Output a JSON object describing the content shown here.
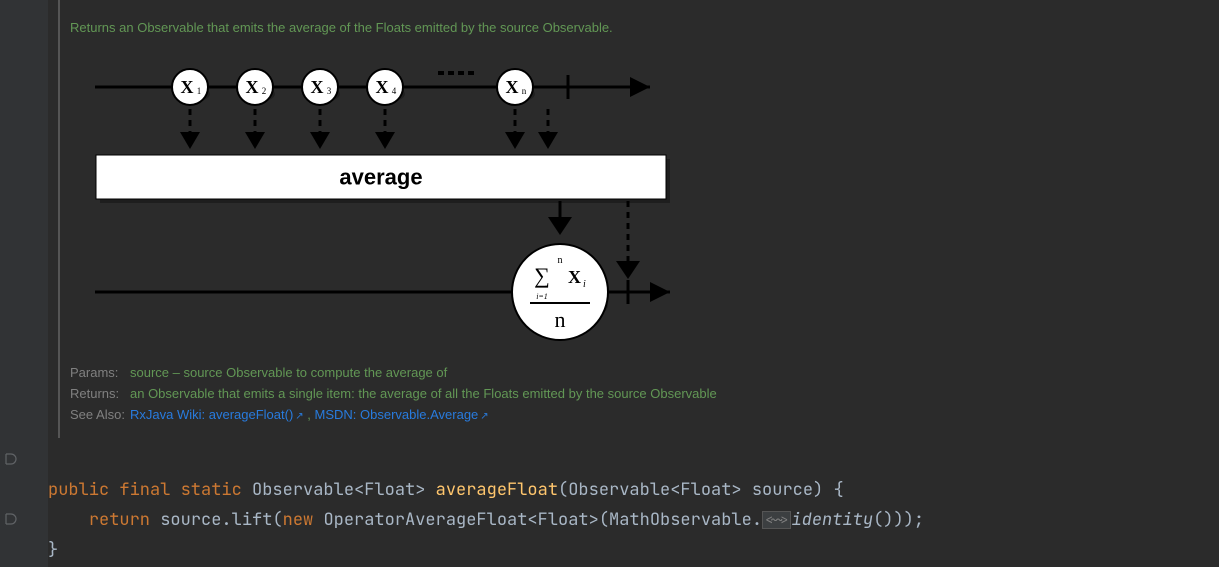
{
  "doc": {
    "summary": "Returns an Observable that emits the average of the Floats emitted by the source Observable.",
    "diagram": {
      "marbles": [
        "1",
        "2",
        "3",
        "4",
        "n"
      ],
      "operator_label": "average"
    },
    "params_label": "Params:",
    "params_value": "source – source Observable to compute the average of",
    "returns_label": "Returns:",
    "returns_value": "an Observable that emits a single item: the average of all the Floats emitted by the source Observable",
    "seealso_label": "See Also:",
    "seealso_links": [
      "RxJava Wiki: averageFloat()",
      "MSDN: Observable.Average"
    ],
    "link_sep": " , "
  },
  "code": {
    "kw_public": "public",
    "kw_final": "final",
    "kw_static": "static",
    "type_obs_float": "Observable<Float>",
    "method_name": "averageFloat",
    "param_type": "Observable<Float>",
    "param_name": "source",
    "brace_open": " {",
    "kw_return": "return",
    "src_lift": "source.lift(",
    "kw_new": "new",
    "ctor": "OperatorAverageFloat<Float>(MathObservable.",
    "folded_marker": "<~>",
    "identity_call": "identity",
    "tail": "()));",
    "brace_close": "}"
  }
}
